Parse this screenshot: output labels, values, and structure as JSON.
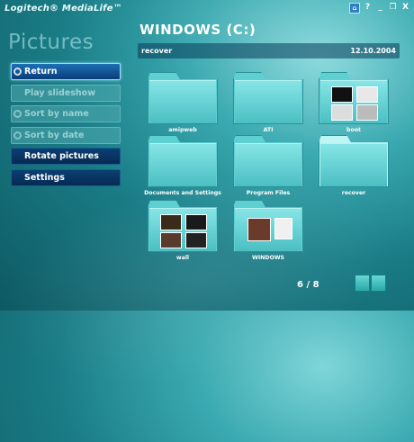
{
  "brand": "Logitech® MediaLife™",
  "window_controls": [
    "home",
    "?",
    "_",
    "restore",
    "X"
  ],
  "section_title": "Pictures",
  "menu": [
    {
      "label": "Return",
      "state": "active",
      "icon": "return-arrow-icon"
    },
    {
      "label": "Play slideshow",
      "state": "dim",
      "icon": null
    },
    {
      "label": "Sort by name",
      "state": "dim",
      "icon": "radio-icon"
    },
    {
      "label": "Sort by date",
      "state": "dim",
      "icon": "radio-icon"
    },
    {
      "label": "Rotate pictures",
      "state": "dark",
      "icon": null
    },
    {
      "label": "Settings",
      "state": "dark",
      "icon": null
    }
  ],
  "drive_title": "WINDOWS (C:)",
  "path_bar": {
    "path": "recover",
    "date": "12.10.2004"
  },
  "folders": [
    {
      "name": "amipweb",
      "thumbs": 0,
      "selected": false
    },
    {
      "name": "ATI",
      "thumbs": 0,
      "selected": false
    },
    {
      "name": "boot",
      "thumbs": 4,
      "selected": false
    },
    {
      "name": "Documents and Settings",
      "thumbs": 0,
      "selected": false
    },
    {
      "name": "Program Files",
      "thumbs": 0,
      "selected": false
    },
    {
      "name": "recover",
      "thumbs": 0,
      "selected": true
    },
    {
      "name": "wall",
      "thumbs": 4,
      "selected": false
    },
    {
      "name": "WINDOWS",
      "thumbs": 2,
      "selected": false
    }
  ],
  "page_counter": "6 / 8",
  "colors": {
    "accent_blue": "#1d6fb5",
    "folder": "#5fd0d2",
    "background": "#1a7c86"
  }
}
